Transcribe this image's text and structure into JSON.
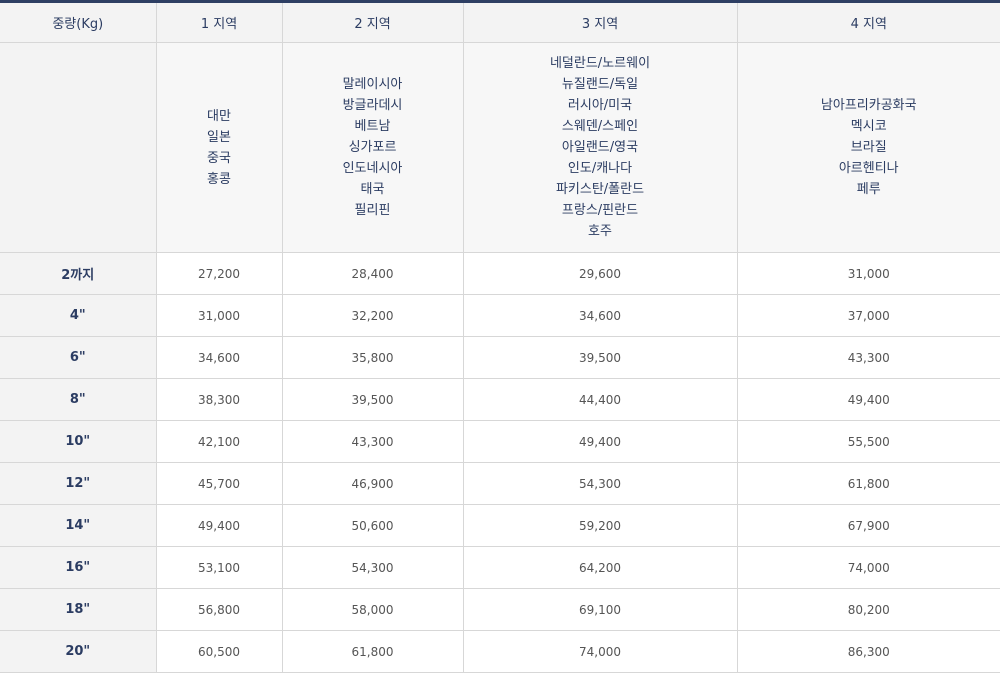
{
  "headers": {
    "weight": "중량(Kg)",
    "zones": [
      "1 지역",
      "2 지역",
      "3 지역",
      "4 지역"
    ]
  },
  "zone_countries": [
    [
      "대만",
      "일본",
      "중국",
      "홍콩"
    ],
    [
      "말레이시아",
      "방글라데시",
      "베트남",
      "싱가포르",
      "인도네시아",
      "태국",
      "필리핀"
    ],
    [
      "네덜란드/노르웨이",
      "뉴질랜드/독일",
      "러시아/미국",
      "스웨덴/스페인",
      "아일랜드/영국",
      "인도/캐나다",
      "파키스탄/폴란드",
      "프랑스/핀란드",
      "호주"
    ],
    [
      "남아프리카공화국",
      "멕시코",
      "브라질",
      "아르헨티나",
      "페루"
    ]
  ],
  "rows": [
    {
      "weight": "2까지",
      "prices": [
        "27,200",
        "28,400",
        "29,600",
        "31,000"
      ]
    },
    {
      "weight": "4\"",
      "prices": [
        "31,000",
        "32,200",
        "34,600",
        "37,000"
      ]
    },
    {
      "weight": "6\"",
      "prices": [
        "34,600",
        "35,800",
        "39,500",
        "43,300"
      ]
    },
    {
      "weight": "8\"",
      "prices": [
        "38,300",
        "39,500",
        "44,400",
        "49,400"
      ]
    },
    {
      "weight": "10\"",
      "prices": [
        "42,100",
        "43,300",
        "49,400",
        "55,500"
      ]
    },
    {
      "weight": "12\"",
      "prices": [
        "45,700",
        "46,900",
        "54,300",
        "61,800"
      ]
    },
    {
      "weight": "14\"",
      "prices": [
        "49,400",
        "50,600",
        "59,200",
        "67,900"
      ]
    },
    {
      "weight": "16\"",
      "prices": [
        "53,100",
        "54,300",
        "64,200",
        "74,000"
      ]
    },
    {
      "weight": "18\"",
      "prices": [
        "56,800",
        "58,000",
        "69,100",
        "80,200"
      ]
    },
    {
      "weight": "20\"",
      "prices": [
        "60,500",
        "61,800",
        "74,000",
        "86,300"
      ]
    }
  ]
}
